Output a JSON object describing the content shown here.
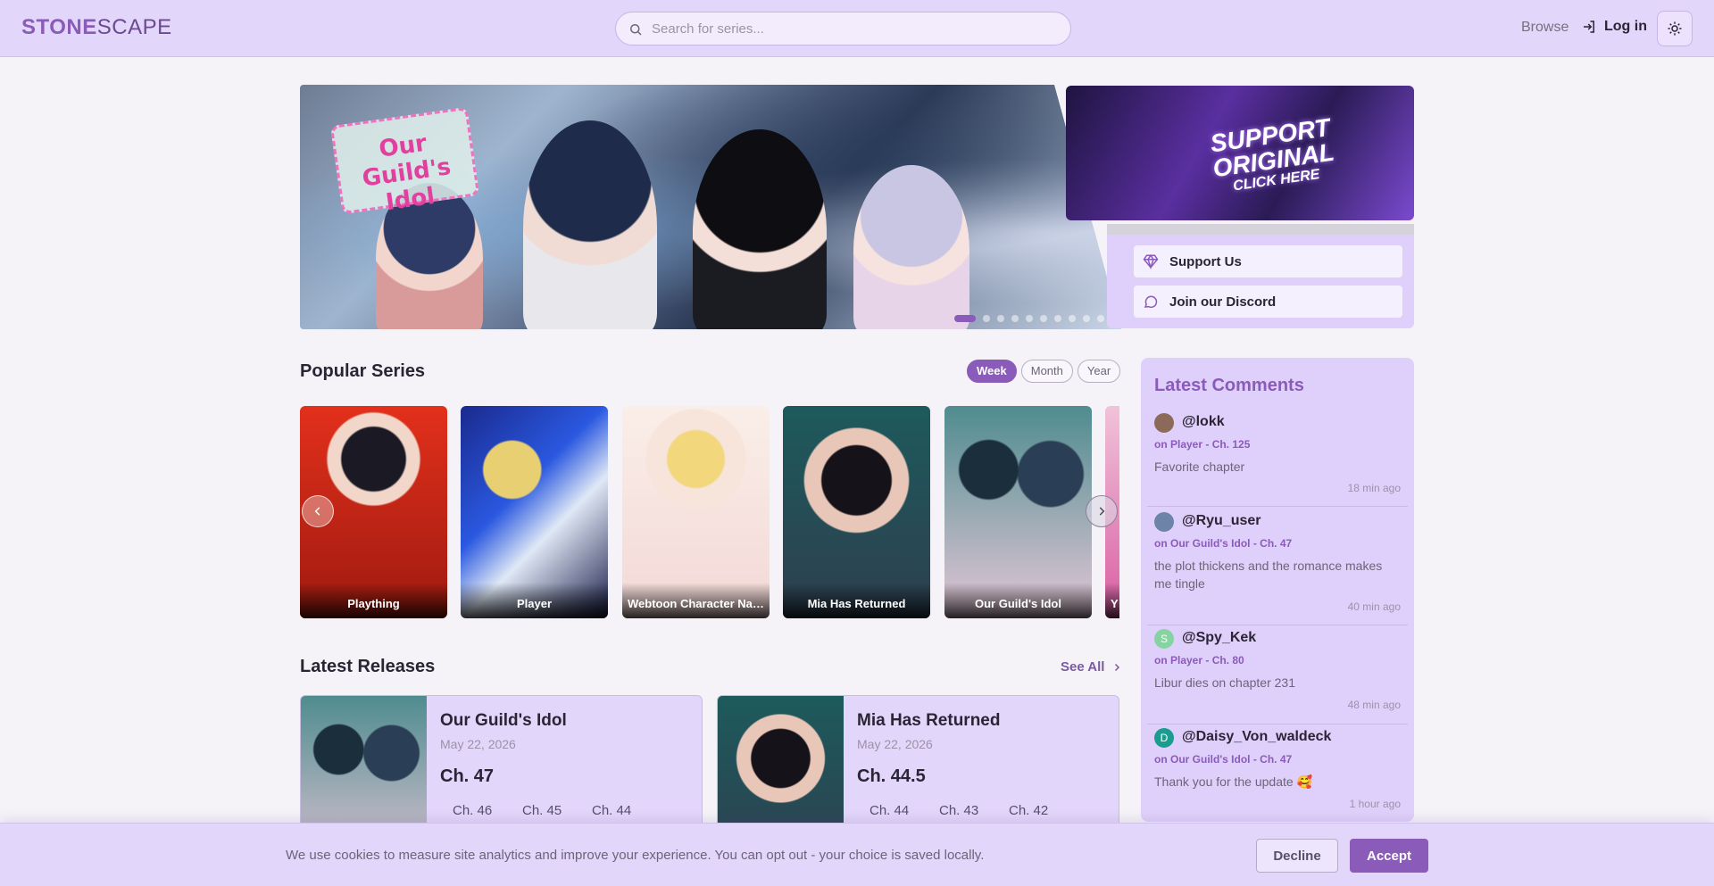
{
  "header": {
    "logo_bold": "STONE",
    "logo_light": "SCAPE",
    "search_placeholder": "Search for series...",
    "browse": "Browse",
    "login": "Log in"
  },
  "hero": {
    "title_art": "Our Guild's Idol",
    "slide_count": 10,
    "active_slide": 1
  },
  "promo": {
    "line1": "SUPPORT",
    "line2": "ORIGINAL",
    "line3": "CLICK HERE"
  },
  "side_links": {
    "support": "Support Us",
    "discord": "Join our Discord"
  },
  "popular": {
    "title": "Popular Series",
    "filters": [
      "Week",
      "Month",
      "Year"
    ],
    "active_filter": "Week",
    "items": [
      {
        "title": "Plaything"
      },
      {
        "title": "Player"
      },
      {
        "title": "Webtoon Character Na Kang Lim"
      },
      {
        "title": "Mia Has Returned"
      },
      {
        "title": "Our Guild's Idol"
      },
      {
        "title": "Y"
      }
    ]
  },
  "releases": {
    "title": "Latest Releases",
    "see_all": "See All",
    "items": [
      {
        "title": "Our Guild's Idol",
        "date": "May 22, 2026",
        "latest": "Ch. 47",
        "prev": [
          "Ch. 46",
          "Ch. 45",
          "Ch. 44"
        ]
      },
      {
        "title": "Mia Has Returned",
        "date": "May 22, 2026",
        "latest": "Ch. 44.5",
        "prev": [
          "Ch. 44",
          "Ch. 43",
          "Ch. 42"
        ]
      }
    ]
  },
  "comments": {
    "title": "Latest Comments",
    "items": [
      {
        "user": "@lokk",
        "on": "on Player - Ch. 125",
        "text": "Favorite chapter",
        "time": "18 min ago",
        "avatar_letter": "",
        "avatar_color": "#8c6a5a"
      },
      {
        "user": "@Ryu_user",
        "on": "on Our Guild's Idol - Ch. 47",
        "text": "the plot thickens and the romance makes me tingle",
        "time": "40 min ago",
        "avatar_letter": "",
        "avatar_color": "#6d83a8"
      },
      {
        "user": "@Spy_Kek",
        "on": "on Player - Ch. 80",
        "text": "Libur dies on chapter 231",
        "time": "48 min ago",
        "avatar_letter": "S",
        "avatar_color": "#86d3a2"
      },
      {
        "user": "@Daisy_Von_waldeck",
        "on": "on Our Guild's Idol - Ch. 47",
        "text": "Thank you for the update 🥰",
        "time": "1 hour ago",
        "avatar_letter": "D",
        "avatar_color": "#1a9c8f"
      }
    ]
  },
  "cookie": {
    "message": "We use cookies to measure site analytics and improve your experience. You can opt out - your choice is saved locally.",
    "decline": "Decline",
    "accept": "Accept"
  },
  "colors": {
    "accent": "#8a5bb8",
    "header_bg": "#e3d6fb",
    "panel_bg": "#dfd0fb"
  }
}
